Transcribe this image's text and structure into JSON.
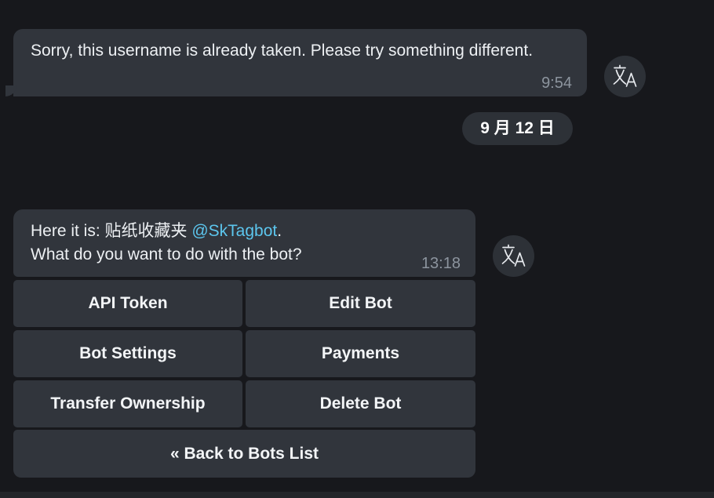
{
  "messages": [
    {
      "text": "Sorry, this username is already taken. Please try something different.",
      "time": "9:54"
    },
    {
      "text_prefix": "Here it is: 贴纸收藏夹 ",
      "mention": "@SkTagbot",
      "text_suffix": ".",
      "line2": "What do you want to do with the bot?",
      "time": "13:18"
    }
  ],
  "date_separator": "9 月 12 日",
  "keyboard": {
    "api_token": "API Token",
    "edit_bot": "Edit Bot",
    "bot_settings": "Bot Settings",
    "payments": "Payments",
    "transfer_ownership": "Transfer Ownership",
    "delete_bot": "Delete Bot",
    "back_to_bots_list": "« Back to Bots List"
  },
  "icons": {
    "translate": "translate-icon"
  },
  "colors": {
    "background": "#17181c",
    "bubble": "#31353c",
    "mention": "#5cc6ee",
    "timestamp": "#8c949e"
  }
}
